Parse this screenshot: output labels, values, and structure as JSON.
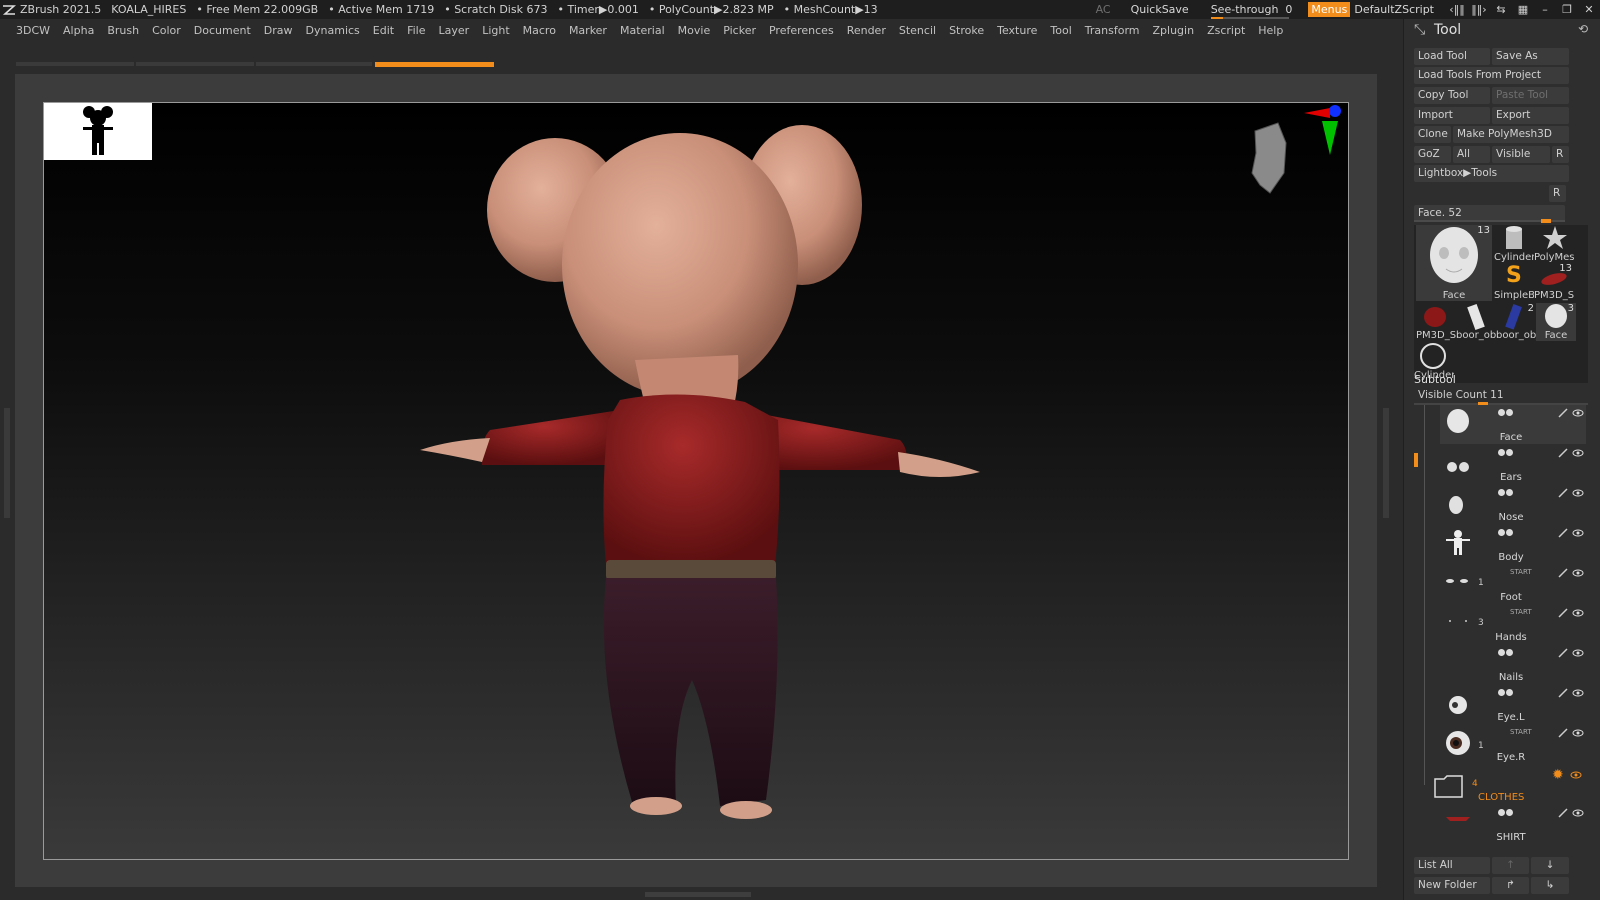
{
  "titlebar": {
    "app": "ZBrush 2021.5",
    "project": "KOALA_HIRES",
    "free_mem": "• Free Mem 22.009GB",
    "active_mem": "• Active Mem 1719",
    "scratch": "• Scratch Disk 673",
    "timer": "• Timer▶0.001",
    "polycount": "• PolyCount▶2.823 MP",
    "meshcount": "• MeshCount▶13",
    "ac": "AC",
    "quicksave": "QuickSave",
    "see_through": "See-through",
    "see_through_value": "0",
    "menus": "Menus",
    "script": "DefaultZScript"
  },
  "menu": [
    "3DCW",
    "Alpha",
    "Brush",
    "Color",
    "Document",
    "Draw",
    "Dynamics",
    "Edit",
    "File",
    "Layer",
    "Light",
    "Macro",
    "Marker",
    "Material",
    "Movie",
    "Picker",
    "Preferences",
    "Render",
    "Stencil",
    "Stroke",
    "Texture",
    "Tool",
    "Transform",
    "Zplugin",
    "Zscript",
    "Help"
  ],
  "tool_panel": {
    "title": "Tool",
    "load_tool": "Load Tool",
    "save_as": "Save As",
    "load_from_project": "Load Tools From Project",
    "copy_tool": "Copy Tool",
    "paste_tool": "Paste Tool",
    "import": "Import",
    "export": "Export",
    "clone": "Clone",
    "make_polymesh": "Make PolyMesh3D",
    "goz": "GoZ",
    "all": "All",
    "visible": "Visible",
    "r": "R",
    "lightbox": "Lightbox▶Tools",
    "face_label": "Face. 52",
    "thumbs": [
      {
        "label": "Face",
        "count": "13"
      },
      {
        "label": "Cylinder",
        "count": ""
      },
      {
        "label": "PolyMes",
        "count": ""
      },
      {
        "label": "SimpleB",
        "count": ""
      },
      {
        "label": "PM3D_S",
        "count": "13"
      },
      {
        "label": "PM3D_S",
        "count": ""
      },
      {
        "label": "boor_obj",
        "count": ""
      },
      {
        "label": "boor_obj",
        "count": "2"
      },
      {
        "label": "Face",
        "count": "3"
      },
      {
        "label": "Cylinder",
        "count": ""
      }
    ]
  },
  "subtool": {
    "title": "Subtool",
    "visible_count": "Visible Count 11",
    "start": "START",
    "items": [
      {
        "name": "Face",
        "count": ""
      },
      {
        "name": "Ears",
        "count": ""
      },
      {
        "name": "Nose",
        "count": ""
      },
      {
        "name": "Body",
        "count": ""
      },
      {
        "name": "Foot",
        "count": "1"
      },
      {
        "name": "Hands",
        "count": "3"
      },
      {
        "name": "Nails",
        "count": ""
      },
      {
        "name": "Eye.L",
        "count": ""
      },
      {
        "name": "Eye.R",
        "count": "1"
      }
    ],
    "folder": {
      "name": "CLOTHES",
      "count": "4"
    },
    "shirt": "SHIRT",
    "list_all": "List All",
    "new_folder": "New Folder"
  }
}
